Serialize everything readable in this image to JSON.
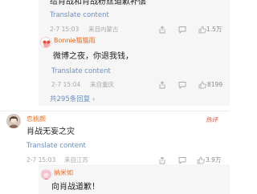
{
  "comments": [
    {
      "text": "给肖战和肖战粉丝道歉补偿",
      "translate": "Translate content",
      "date": "2-7 15:03",
      "source": "来自内蒙古",
      "likes": "1.5万"
    },
    {
      "name": "Bonnie猫猫雨",
      "text": "微博之夜，你退我钱，",
      "translate": "Translate content",
      "date": "2-7 15:04",
      "source": "来自重庆",
      "likes": "8199"
    }
  ],
  "total_replies": "共295条回复",
  "second_thread": {
    "name": "恋桃颜",
    "text": "肖战无妄之灾",
    "translate": "Translate content",
    "date": "2-7 15:03",
    "source": "来自江苏",
    "likes": "3.9万",
    "badge": "热评",
    "reply": {
      "name": "纳米如",
      "text": "向肖战道歉！"
    }
  },
  "colors": {
    "name": "#e86a1e",
    "link": "#6b8fbf",
    "meta": "#a8a8a8",
    "badge": "#e84a3a"
  }
}
